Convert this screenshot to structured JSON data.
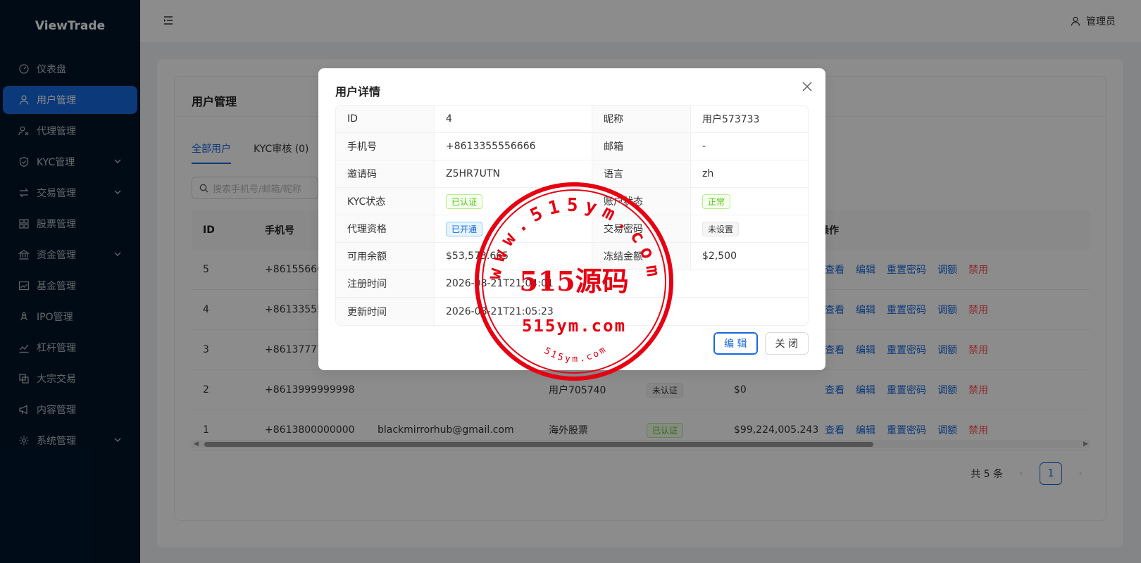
{
  "app": {
    "name": "ViewTrade"
  },
  "sidebar": {
    "items": [
      {
        "label": "仪表盘",
        "icon": "dashboard-icon",
        "active": false,
        "has_children": false
      },
      {
        "label": "用户管理",
        "icon": "user-icon",
        "active": true,
        "has_children": false
      },
      {
        "label": "代理管理",
        "icon": "agent-icon",
        "active": false,
        "has_children": false
      },
      {
        "label": "KYC管理",
        "icon": "shield-icon",
        "active": false,
        "has_children": true
      },
      {
        "label": "交易管理",
        "icon": "swap-icon",
        "active": false,
        "has_children": true
      },
      {
        "label": "股票管理",
        "icon": "grid-icon",
        "active": false,
        "has_children": false
      },
      {
        "label": "资金管理",
        "icon": "bank-icon",
        "active": false,
        "has_children": true
      },
      {
        "label": "基金管理",
        "icon": "fund-chart-icon",
        "active": false,
        "has_children": false
      },
      {
        "label": "IPO管理",
        "icon": "rocket-icon",
        "active": false,
        "has_children": false
      },
      {
        "label": "杠杆管理",
        "icon": "leverage-chart-icon",
        "active": false,
        "has_children": false
      },
      {
        "label": "大宗交易",
        "icon": "block-trade-icon",
        "active": false,
        "has_children": false
      },
      {
        "label": "内容管理",
        "icon": "megaphone-icon",
        "active": false,
        "has_children": false
      },
      {
        "label": "系统管理",
        "icon": "settings-icon",
        "active": false,
        "has_children": true
      }
    ]
  },
  "header": {
    "user_label": "管理员"
  },
  "page": {
    "title": "用户管理",
    "tabs": [
      {
        "label": "全部用户",
        "active": true
      },
      {
        "label": "KYC审核 (0)",
        "active": false
      }
    ],
    "search_placeholder": "搜索手机号/邮箱/昵称",
    "table": {
      "columns": {
        "id": "ID",
        "phone": "手机号",
        "actions": "操作"
      },
      "rows": [
        {
          "id": "5",
          "phone": "+861556666",
          "email": "",
          "nickname": "",
          "kyc": "",
          "balance": ""
        },
        {
          "id": "4",
          "phone": "+861335555",
          "email": "",
          "nickname": "",
          "kyc": "",
          "balance": ""
        },
        {
          "id": "3",
          "phone": "+861377777",
          "email": "",
          "nickname": "",
          "kyc": "",
          "balance": ""
        },
        {
          "id": "2",
          "phone": "+8613999999998",
          "email": "",
          "nickname": "用户705740",
          "kyc": "未认证",
          "balance": "$0"
        },
        {
          "id": "1",
          "phone": "+8613800000000",
          "email": "blackmirrorhub@gmail.com",
          "nickname": "海外股票",
          "kyc": "已认证",
          "balance": "$99,224,005.243"
        }
      ],
      "actions": {
        "view": "查看",
        "edit": "编辑",
        "reset_password": "重置密码",
        "adjust": "调额",
        "disable": "禁用"
      }
    },
    "pagination": {
      "total_text": "共 5 条",
      "current_page": "1"
    }
  },
  "modal": {
    "title": "用户详情",
    "fields": {
      "id_label": "ID",
      "id_value": "4",
      "nickname_label": "昵称",
      "nickname_value": "用户573733",
      "phone_label": "手机号",
      "phone_value": "+8613355556666",
      "email_label": "邮箱",
      "email_value": "-",
      "invite_label": "邀请码",
      "invite_value": "Z5HR7UTN",
      "lang_label": "语言",
      "lang_value": "zh",
      "kyc_label": "KYC状态",
      "kyc_value": "已认证",
      "account_label": "账户状态",
      "account_value": "正常",
      "agent_label": "代理资格",
      "agent_value": "已开通",
      "tradepwd_label": "交易密码",
      "tradepwd_value": "未设置",
      "balance_label": "可用余额",
      "balance_value": "$53,573.665",
      "frozen_label": "冻结金额",
      "frozen_value": "$2,500",
      "created_label": "注册时间",
      "created_value": "2026-08-21T21:04:01",
      "updated_label": "更新时间",
      "updated_value": "2026-08-21T21:05:23"
    },
    "edit_button": "编 辑",
    "close_button": "关 闭"
  },
  "watermark": {
    "top_arc": "www.515ym.com",
    "center": "515源码",
    "domain": "515ym.com",
    "bottom_arc": "515ym.com",
    "color": "#e60012"
  },
  "colors": {
    "primary": "#1668dc",
    "sidebar_bg": "#001529",
    "danger": "#ff4d4f",
    "success": "#52c41a"
  }
}
